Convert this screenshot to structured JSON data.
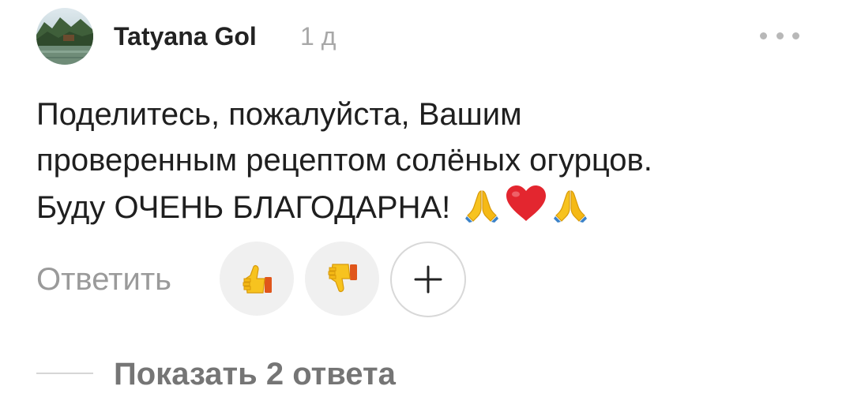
{
  "comment": {
    "author": "Tatyana Gol",
    "time": "1 д",
    "text_lines": [
      "Поделитесь, пожалуйста, Вашим",
      "проверенным рецептом солёных огурцов.",
      "Буду ОЧЕНЬ БЛАГОДАРНА!"
    ],
    "emojis": [
      "folded-hands",
      "red-heart",
      "folded-hands"
    ]
  },
  "actions": {
    "reply_label": "Ответить",
    "reactions": [
      "thumbs-up-icon",
      "thumbs-down-icon",
      "add-reaction-icon"
    ]
  },
  "replies": {
    "show_label": "Показать 2 ответа"
  },
  "colors": {
    "author": "#222222",
    "muted": "#a8a8a8",
    "reaction_bg": "#f0f0f0",
    "thumb_yellow": "#f7c31f",
    "thumb_orange": "#e06a1b",
    "heart_red": "#e3262f"
  }
}
